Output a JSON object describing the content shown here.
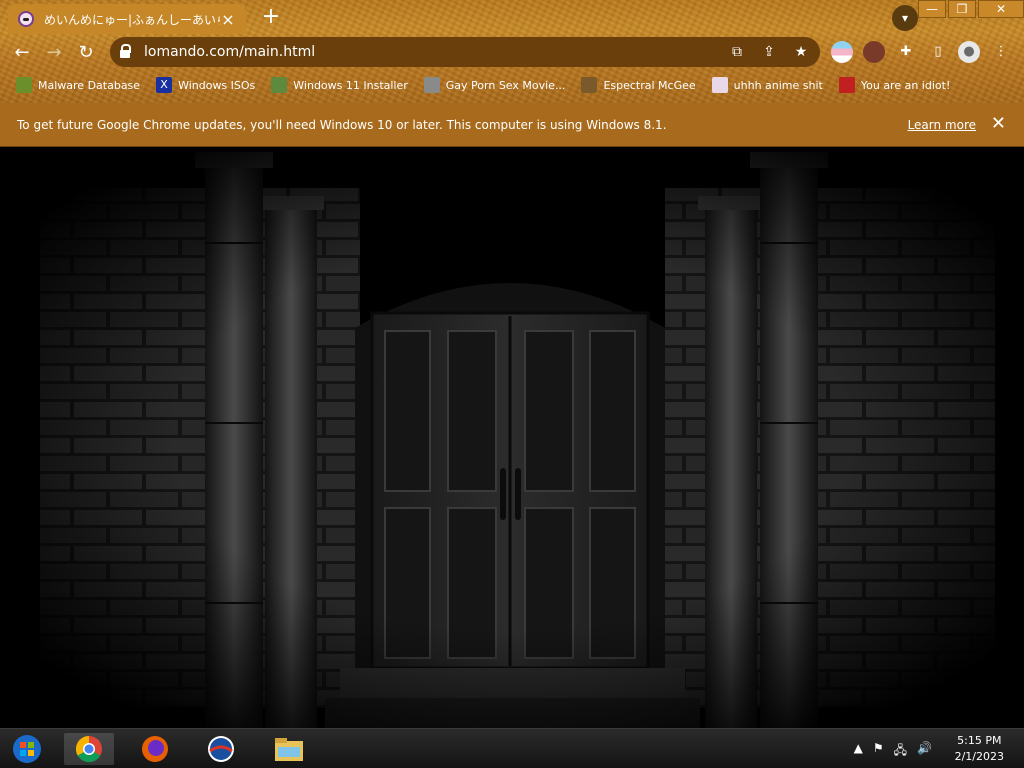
{
  "tab": {
    "title": "めいんめにゅー|ふぁんしーあいらんど",
    "close": "×",
    "new_tab": "+"
  },
  "window_buttons": {
    "minimize": "—",
    "maximize": "❐",
    "close": "✕"
  },
  "toolbar": {
    "back": "←",
    "forward": "→",
    "reload": "↻",
    "url": "lomando.com/main.html",
    "translate_icon": "translate-icon",
    "share_icon": "share-icon",
    "bookmark_icon": "star-icon"
  },
  "bookmarks": [
    {
      "label": "Malware Database",
      "color": "#6b8f2a"
    },
    {
      "label": "Windows ISOs",
      "color": "#1a2fa0"
    },
    {
      "label": "Windows 11 Installer",
      "color": "#5d8a3c"
    },
    {
      "label": "Gay Porn Sex Movie...",
      "color": "#8a8a8a"
    },
    {
      "label": "Espectral McGee",
      "color": "#7a5a2a"
    },
    {
      "label": "uhhh anime shit",
      "color": "#e8d8e8"
    },
    {
      "label": "You are an idiot!",
      "color": "#c02020"
    }
  ],
  "infobar": {
    "message": "To get future Google Chrome updates, you'll need Windows 10 or later. This computer is using Windows 8.1.",
    "link": "Learn more",
    "close": "✕"
  },
  "taskbar": {
    "time": "5:15 PM",
    "date": "2/1/2023",
    "tray": [
      "▲",
      "⚑",
      "🖧",
      "🔊"
    ]
  },
  "colors": {
    "accent": "#c58727",
    "infobar": "#a86a1c",
    "taskbar": "#1c1c1c"
  }
}
